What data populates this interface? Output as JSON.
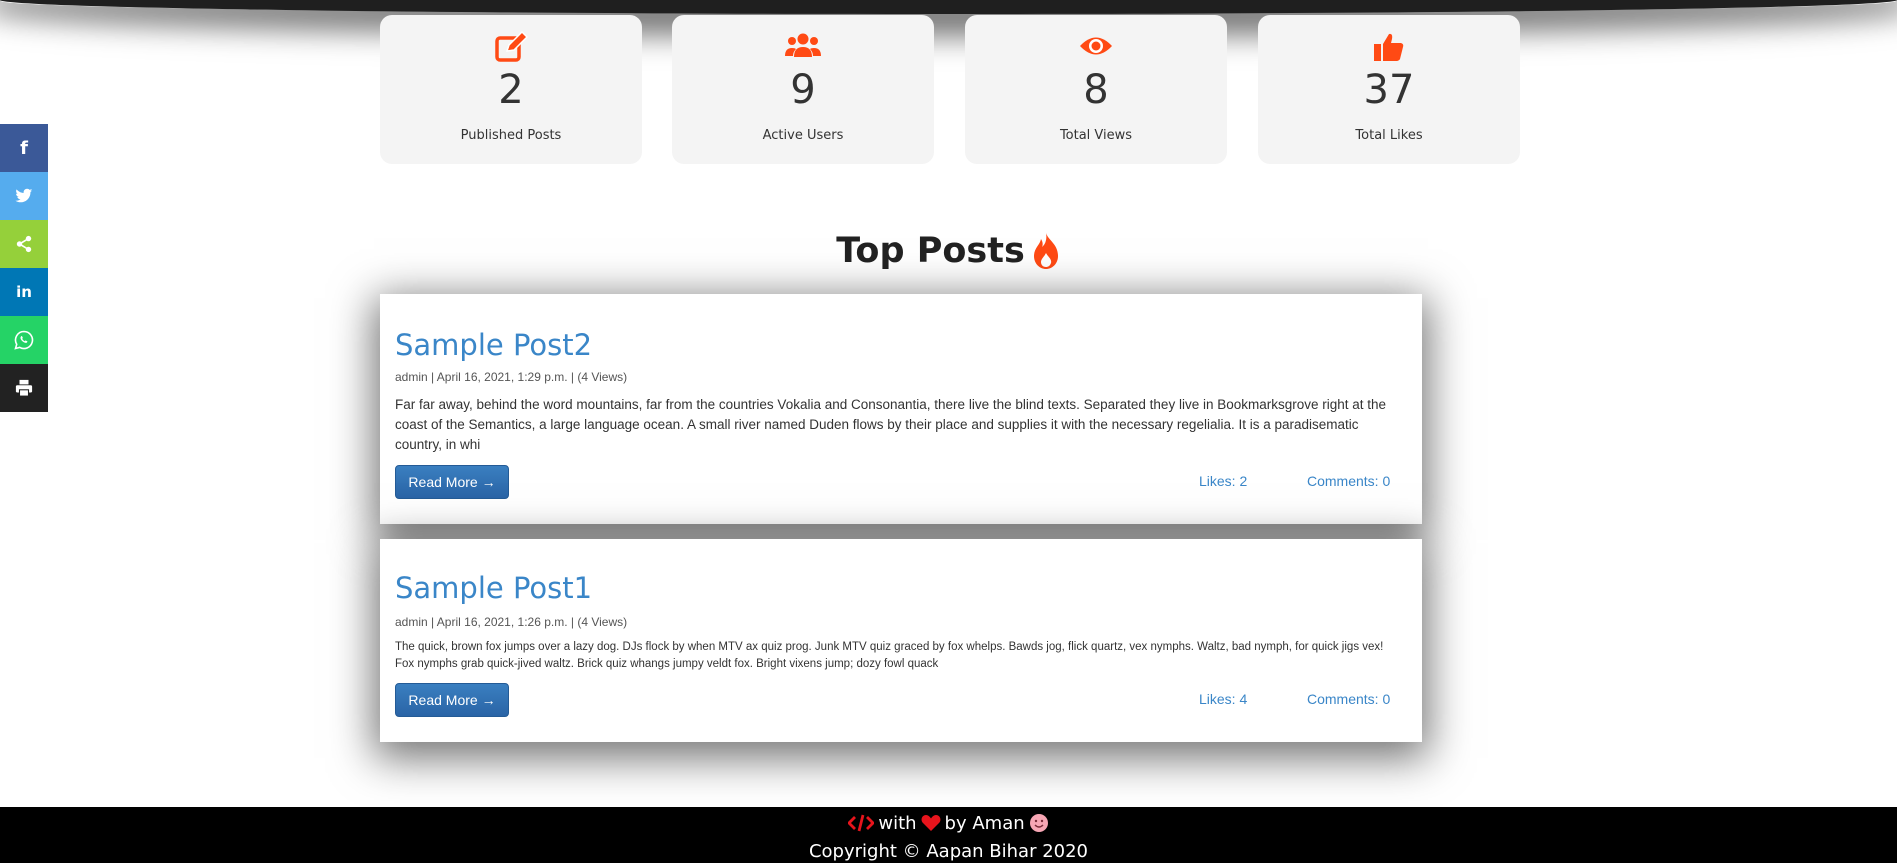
{
  "stats": [
    {
      "icon": "edit-icon",
      "count": "2",
      "label": "Published Posts"
    },
    {
      "icon": "users-icon",
      "count": "9",
      "label": "Active Users"
    },
    {
      "icon": "eye-icon",
      "count": "8",
      "label": "Total Views"
    },
    {
      "icon": "thumbs-up-icon",
      "count": "37",
      "label": "Total Likes"
    }
  ],
  "share_bar": [
    {
      "icon": "facebook-icon",
      "color": "#3b5998"
    },
    {
      "icon": "twitter-icon",
      "color": "#55acee"
    },
    {
      "icon": "share-icon",
      "color": "#95d03a"
    },
    {
      "icon": "linkedin-icon",
      "color": "#0077b5"
    },
    {
      "icon": "whatsapp-icon",
      "color": "#25d366"
    },
    {
      "icon": "print-icon",
      "color": "#222222"
    }
  ],
  "heading": {
    "text": "Top Posts",
    "icon": "fire-icon"
  },
  "posts": [
    {
      "title": "Sample Post2",
      "meta": "admin | April 16, 2021, 1:29 p.m. | (4 Views)",
      "excerpt": "Far far away, behind the word mountains, far from the countries Vokalia and Consonantia, there live the blind texts. Separated they live in Bookmarksgrove right at the coast of the Semantics, a large language ocean. A small river named Duden flows by their place and supplies it with the necessary regelialia. It is a paradisematic country, in whi",
      "read_more": "Read More →",
      "likes": "Likes: 2",
      "comments": "Comments: 0"
    },
    {
      "title": "Sample Post1",
      "meta": "admin | April 16, 2021, 1:26 p.m. | (4 Views)",
      "excerpt": "The quick, brown fox jumps over a lazy dog. DJs flock by when MTV ax quiz prog. Junk MTV quiz graced by fox whelps. Bawds jog, flick quartz, vex nymphs. Waltz, bad nymph, for quick jigs vex! Fox nymphs grab quick-jived waltz. Brick quiz whangs jumpy veldt fox. Bright vixens jump; dozy fowl quack",
      "read_more": "Read More →",
      "likes": "Likes: 4",
      "comments": "Comments: 0"
    }
  ],
  "footer": {
    "with_text": "with",
    "by_text": "by Aman",
    "copyright": "Copyright © Aapan Bihar 2020"
  },
  "colors": {
    "accent": "#ff4a14",
    "link": "#3a86c8",
    "button": "#2f6fb2",
    "card_bg": "#f4f4f4",
    "footer_bg": "#000000"
  }
}
